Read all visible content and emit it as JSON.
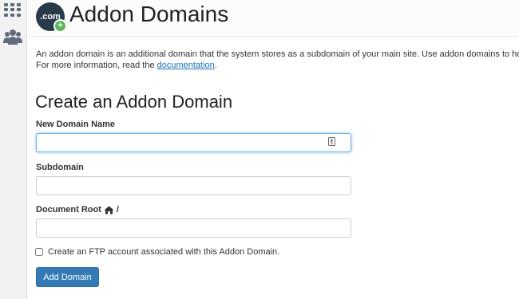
{
  "sidebar": {
    "items": [
      {
        "icon": "grid-icon"
      },
      {
        "icon": "users-icon"
      }
    ]
  },
  "header": {
    "logo_text": ".com",
    "logo_badge": "+",
    "title": "Addon Domains"
  },
  "intro": {
    "line1": "An addon domain is an additional domain that the system stores as a subdomain of your main site. Use addon domains to ho",
    "line2_prefix": "For more information, read the ",
    "doc_link": "documentation",
    "line2_suffix": "."
  },
  "form": {
    "title": "Create an Addon Domain",
    "new_domain_label": "New Domain Name",
    "new_domain_value": "",
    "subdomain_label": "Subdomain",
    "subdomain_value": "",
    "docroot_label": "Document Root",
    "docroot_suffix": "/",
    "docroot_value": "",
    "ftp_label": "Create an FTP account associated with this Addon Domain.",
    "ftp_checked": false,
    "submit_label": "Add Domain"
  },
  "colors": {
    "primary": "#337ab7",
    "link": "#1a73b8",
    "logo_bg": "#293a4a",
    "badge_green": "#5cb85c",
    "focus": "#66afe9"
  }
}
